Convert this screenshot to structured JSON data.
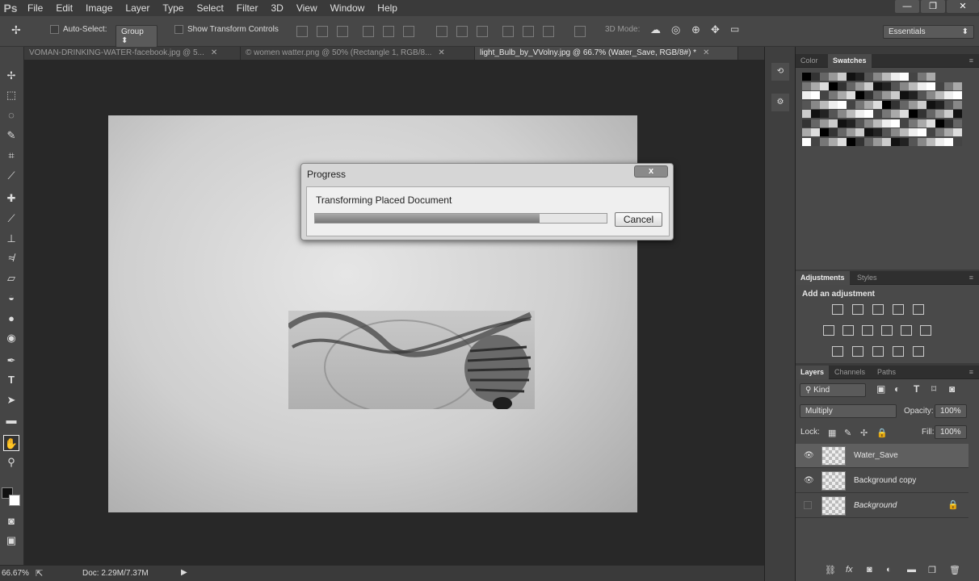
{
  "app": {
    "logo": "Ps"
  },
  "menu": [
    "File",
    "Edit",
    "Image",
    "Layer",
    "Type",
    "Select",
    "Filter",
    "3D",
    "View",
    "Window",
    "Help"
  ],
  "options": {
    "move_icon": "move-tool-icon",
    "auto_select_label": "Auto-Select:",
    "auto_select_value": "Group",
    "show_transform_label": "Show Transform Controls",
    "mode_3d_label": "3D Mode:",
    "workspace": "Essentials"
  },
  "tabs": [
    {
      "label": "VOMAN-DRINKING-WATER-facebook.jpg @ 5...",
      "active": false
    },
    {
      "label": "© women watter.png @ 50% (Rectangle 1, RGB/8...",
      "active": false
    },
    {
      "label": "light_Bulb_by_VVolny.jpg @ 66.7% (Water_Save, RGB/8#) *",
      "active": true
    }
  ],
  "tools": [
    "move-tool-icon",
    "marquee-tool-icon",
    "lasso-tool-icon",
    "quick-select-icon",
    "crop-tool-icon",
    "eyedropper-icon",
    "healing-brush-icon",
    "brush-tool-icon",
    "clone-stamp-icon",
    "history-brush-icon",
    "eraser-icon",
    "paint-bucket-icon",
    "blur-tool-icon",
    "dodge-tool-icon",
    "pen-tool-icon",
    "type-tool-icon",
    "path-select-icon",
    "rectangle-tool-icon",
    "hand-tool-icon",
    "zoom-tool-icon"
  ],
  "progress": {
    "title": "Progress",
    "close": "x",
    "message": "Transforming Placed Document",
    "value_percent": 77,
    "cancel": "Cancel"
  },
  "panels": {
    "color_tab": "Color",
    "swatches_tab": "Swatches",
    "adjustments_tab": "Adjustments",
    "styles_tab": "Styles",
    "add_adjustment": "Add an adjustment",
    "layers_tab": "Layers",
    "channels_tab": "Channels",
    "paths_tab": "Paths",
    "kind": "Kind",
    "blend_mode": "Multiply",
    "opacity_label": "Opacity:",
    "opacity_value": "100%",
    "lock_label": "Lock:",
    "fill_label": "Fill:",
    "fill_value": "100%"
  },
  "layers": [
    {
      "name": "Water_Save",
      "visible": true,
      "selected": true
    },
    {
      "name": "Background copy",
      "visible": true,
      "selected": false
    },
    {
      "name": "Background",
      "visible": false,
      "selected": false,
      "locked": true
    }
  ],
  "status": {
    "zoom": "66.67%",
    "doc": "Doc: 2.29M/7.37M"
  }
}
